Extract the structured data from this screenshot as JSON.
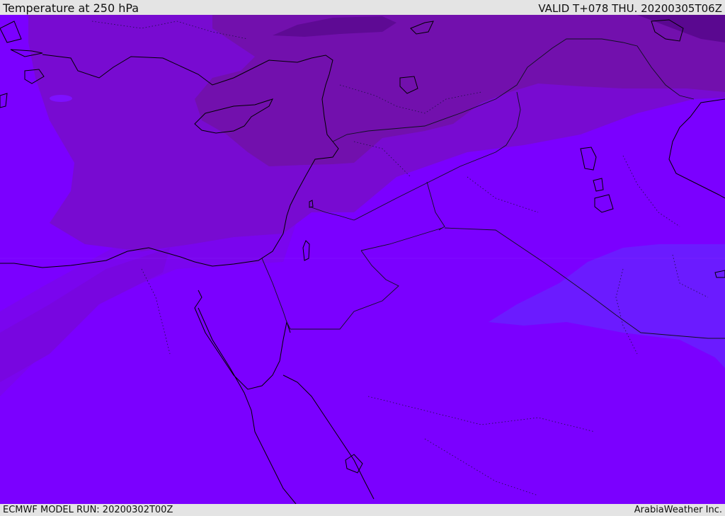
{
  "header": {
    "title": "Temperature at 250 hPa",
    "valid": "VALID T+078 THU. 20200305T06Z"
  },
  "footer": {
    "model_run": "ECMWF MODEL RUN: 20200302T00Z",
    "brand": "ArabiaWeather Inc."
  },
  "map": {
    "field": "temperature",
    "level_hpa": 250,
    "colors": {
      "base": "#7b00ff",
      "mid": "#7a05ee",
      "warm_band": "#780bd1",
      "cold_north": "#7210ad",
      "coldest": "#5e0a94",
      "cool_patch": "#6b1bff",
      "coastline": "#000000",
      "borders": "#101020"
    }
  }
}
